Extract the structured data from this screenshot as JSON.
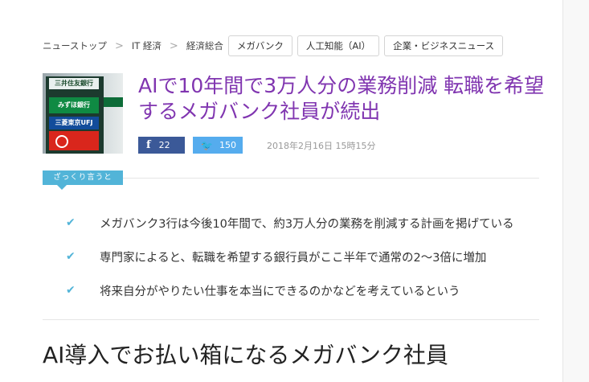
{
  "breadcrumb": {
    "items": [
      "ニューストップ",
      "IT 経済",
      "経済総合"
    ],
    "separator": ">"
  },
  "tags": [
    "メガバンク",
    "人工知能（AI）",
    "企業・ビジネスニュース"
  ],
  "article": {
    "thumbnail_signs": [
      "三井住友銀行",
      "みずほ銀行",
      "三菱東京UFJ"
    ],
    "title": "AIで10年間で3万人分の業務削減 転職を希望するメガバンク社員が続出",
    "share": {
      "facebook": {
        "icon": "f",
        "count": "22"
      },
      "twitter": {
        "icon": "🐦",
        "count": "150"
      }
    },
    "date": "2018年2月16日 15時15分"
  },
  "summary": {
    "label": "ざっくり言うと",
    "items": [
      "メガバンク3行は今後10年間で、約3万人分の業務を削減する計画を掲げている",
      "専門家によると、転職を希望する銀行員がここ半年で通常の2〜3倍に増加",
      "将来自分がやりたい仕事を本当にできるのかなどを考えているという"
    ],
    "check_icon": "✔"
  },
  "section": {
    "heading": "AI導入でお払い箱になるメガバンク社員"
  },
  "colors": {
    "title": "#8035b0",
    "facebook": "#3b5998",
    "twitter": "#55acee",
    "accent": "#52b4d8"
  }
}
